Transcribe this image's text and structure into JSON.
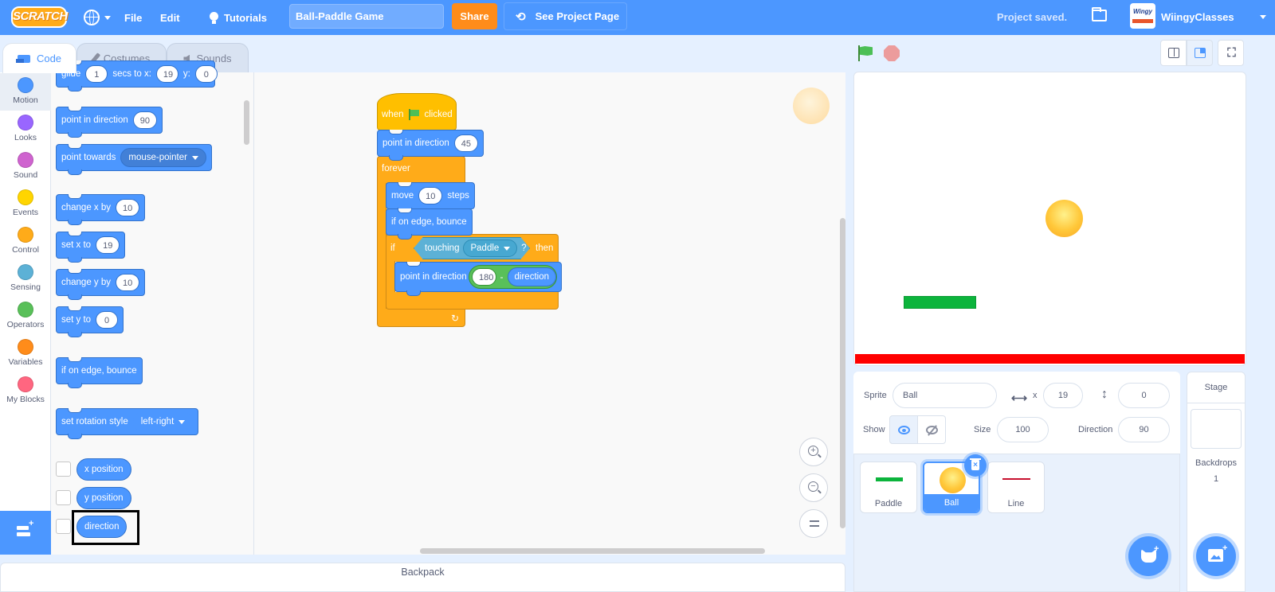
{
  "menubar": {
    "logo": "SCRATCH",
    "file": "File",
    "edit": "Edit",
    "tutorials": "Tutorials",
    "project_title": "Ball-Paddle Game",
    "share": "Share",
    "see_project_page": "See Project Page",
    "status": "Project saved.",
    "avatar_text": "Wingy",
    "username": "WiingyClasses"
  },
  "tabs": [
    {
      "label": "Code",
      "active": true
    },
    {
      "label": "Costumes",
      "active": false
    },
    {
      "label": "Sounds",
      "active": false
    }
  ],
  "categories": [
    {
      "label": "Motion",
      "color": "#4c97ff",
      "active": true
    },
    {
      "label": "Looks",
      "color": "#9966ff"
    },
    {
      "label": "Sound",
      "color": "#cf63cf"
    },
    {
      "label": "Events",
      "color": "#ffd500"
    },
    {
      "label": "Control",
      "color": "#ffab19"
    },
    {
      "label": "Sensing",
      "color": "#5cb1d6"
    },
    {
      "label": "Operators",
      "color": "#59c059"
    },
    {
      "label": "Variables",
      "color": "#ff8c1a"
    },
    {
      "label": "My Blocks",
      "color": "#ff6680"
    }
  ],
  "palette": {
    "glide_partial": {
      "text1": "glide",
      "v1": "1",
      "text2": "secs to x:",
      "v2": "19",
      "text3": "y:",
      "v3": "0"
    },
    "point_in_direction": {
      "label": "point in direction",
      "value": "90"
    },
    "point_towards": {
      "label": "point towards",
      "value": "mouse-pointer"
    },
    "change_x": {
      "label": "change x by",
      "value": "10"
    },
    "set_x": {
      "label": "set x to",
      "value": "19"
    },
    "change_y": {
      "label": "change y by",
      "value": "10"
    },
    "set_y": {
      "label": "set y to",
      "value": "0"
    },
    "bounce": {
      "label": "if on edge, bounce"
    },
    "rotation_style": {
      "label": "set rotation style",
      "value": "left-right"
    },
    "reporters": [
      {
        "label": "x position",
        "checked": false
      },
      {
        "label": "y position",
        "checked": false
      },
      {
        "label": "direction",
        "checked": false,
        "highlighted": true
      }
    ]
  },
  "script": {
    "hat": {
      "when": "when",
      "clicked": "clicked"
    },
    "point_dir": {
      "label": "point in direction",
      "value": "45"
    },
    "forever": "forever",
    "move": {
      "label": "move",
      "value": "10",
      "suffix": "steps"
    },
    "bounce": "if on edge, bounce",
    "if_block": {
      "if": "if",
      "then": "then",
      "touching": "touching",
      "target": "Paddle",
      "question": "?"
    },
    "inner_point": {
      "label": "point in direction",
      "value": "180",
      "operator": "-",
      "reporter": "direction"
    }
  },
  "zoom_controls": {
    "zoom_in": "+",
    "zoom_out": "−"
  },
  "backpack": "Backpack",
  "sprite_info": {
    "sprite_label": "Sprite",
    "sprite_name": "Ball",
    "x_label": "x",
    "x_value": "19",
    "y_label": "y",
    "y_value": "0",
    "show_label": "Show",
    "visible": true,
    "size_label": "Size",
    "size_value": "100",
    "direction_label": "Direction",
    "direction_value": "90"
  },
  "sprites": [
    {
      "name": "Paddle",
      "selected": false
    },
    {
      "name": "Ball",
      "selected": true
    },
    {
      "name": "Line",
      "selected": false
    }
  ],
  "stage_pane": {
    "label": "Stage",
    "backdrops_label": "Backdrops",
    "backdrops_count": "1"
  },
  "colors": {
    "accent": "#4c97ff",
    "share": "#ff8c1a",
    "events": "#ffbf00",
    "control": "#ffab19",
    "sensing": "#5cb1d6",
    "operators": "#59c059",
    "paddle": "#0cb43c",
    "line": "#ff0000"
  }
}
